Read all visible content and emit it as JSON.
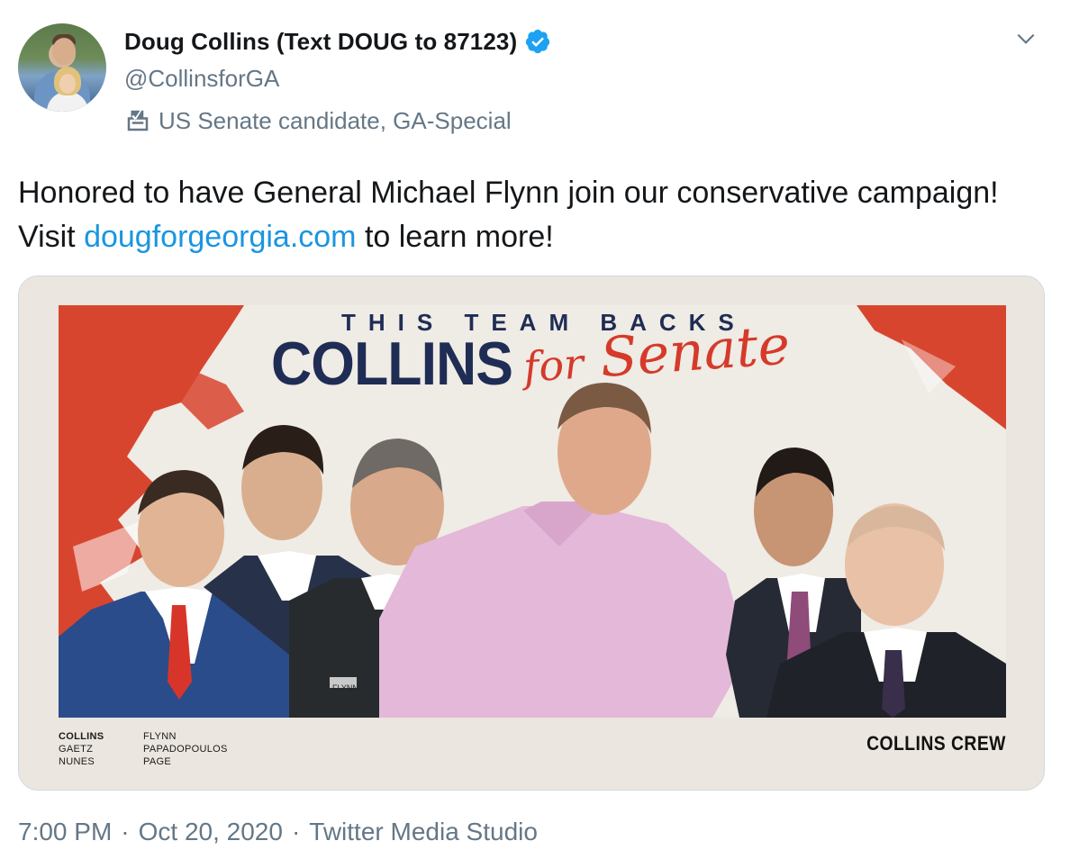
{
  "tweet": {
    "author": {
      "display_name": "Doug Collins (Text DOUG to 87123)",
      "handle": "@CollinsforGA",
      "label": "US Senate candidate, GA-Special",
      "verified": true
    },
    "text_before_link": "Honored to have General Michael Flynn join our conservative campaign! Visit ",
    "link_text": "dougforgeorgia.com",
    "text_after_link": " to learn more!",
    "media": {
      "header_small": "THIS TEAM BACKS",
      "header_big": "COLLINS",
      "header_script_for": "for",
      "header_script_senate": "Senate",
      "names_left": [
        "COLLINS",
        "GAETZ",
        "NUNES"
      ],
      "names_right": [
        "FLYNN",
        "PAPADOPOULOS",
        "PAGE"
      ],
      "crew_label": "COLLINS CREW",
      "uniform_tag": "FLYNN"
    },
    "footer": {
      "time": "7:00 PM",
      "separator1": "·",
      "date": "Oct 20, 2020",
      "separator2": "·",
      "source": "Twitter Media Studio"
    }
  },
  "colors": {
    "verified_blue": "#1da1f2",
    "link_blue": "#1b95e0",
    "muted_gray": "#657786",
    "brand_navy": "#1f2d55",
    "brand_red": "#d53a2a"
  },
  "icons": {
    "verified": "verified-badge-icon",
    "caret": "chevron-down-icon",
    "ballot": "ballot-box-icon"
  }
}
